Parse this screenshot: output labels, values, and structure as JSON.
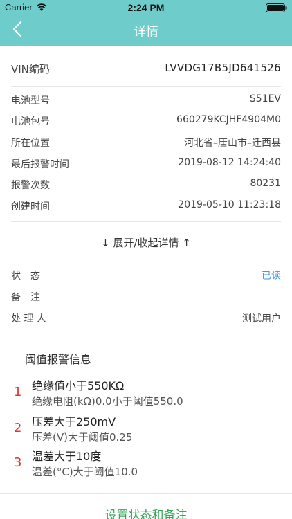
{
  "statusbar": {
    "carrier": "Carrier",
    "time": "2:24 PM"
  },
  "nav": {
    "title": "详情"
  },
  "vin": {
    "label": "VIN编码",
    "value": "LVVDG17B5JD641526"
  },
  "details": [
    {
      "label": "电池型号",
      "value": "S51EV"
    },
    {
      "label": "电池包号",
      "value": "660279KCJHF4904M0"
    },
    {
      "label": "所在位置",
      "value": "河北省–唐山市–迁西县"
    },
    {
      "label": "最后报警时间",
      "value": "2019-08-12 14:24:40"
    },
    {
      "label": "报警次数",
      "value": "80231"
    },
    {
      "label": "创建时间",
      "value": "2019-05-10 11:23:18"
    }
  ],
  "toggle_label": "↓ 展开/收起详情 ↑",
  "status": [
    {
      "label": "状　态",
      "value": "已读"
    },
    {
      "label": "备　注",
      "value": ""
    },
    {
      "label": "处 理 人",
      "value": "测试用户"
    }
  ],
  "threshold": {
    "title": "阈值报警信息",
    "items": [
      {
        "num": "1",
        "title": "绝缘值小于550KΩ",
        "detail": "绝缘电阻(kΩ)0.0小于阈值550.0"
      },
      {
        "num": "2",
        "title": "压差大于250mV",
        "detail": "压差(V)大于阈值0.25"
      },
      {
        "num": "3",
        "title": "温差大于10度",
        "detail": "温差(°C)大于阈值10.0"
      }
    ]
  },
  "action_label": "设置状态和备注",
  "colors": {
    "header": "#6ecdca",
    "status_read": "#3a9be0",
    "alarm_number": "#e0382c",
    "action": "#35a85a"
  }
}
